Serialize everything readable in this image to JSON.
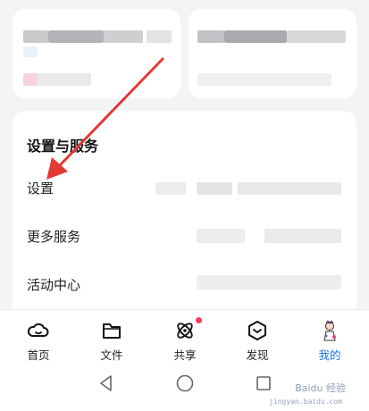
{
  "settings_section": {
    "title": "设置与服务",
    "items": [
      {
        "label": "设置"
      },
      {
        "label": "更多服务"
      },
      {
        "label": "活动中心"
      }
    ]
  },
  "bottom_nav": {
    "items": [
      {
        "label": "首页",
        "icon": "cloud-home-icon"
      },
      {
        "label": "文件",
        "icon": "folder-icon"
      },
      {
        "label": "共享",
        "icon": "share-orbit-icon",
        "badge": true
      },
      {
        "label": "发现",
        "icon": "discover-cube-icon"
      },
      {
        "label": "我的",
        "icon": "avatar-icon",
        "active": true
      }
    ]
  },
  "system_nav": {
    "buttons": [
      "back-icon",
      "home-circle-icon",
      "recent-apps-icon"
    ]
  },
  "watermark": {
    "text": "Baidu 经验",
    "sub": "jingyan.baidu.com"
  },
  "colors": {
    "accent": "#1a73e8",
    "arrow": "#e53935",
    "badge": "#ff3b62",
    "background": "#f3f4f6"
  }
}
